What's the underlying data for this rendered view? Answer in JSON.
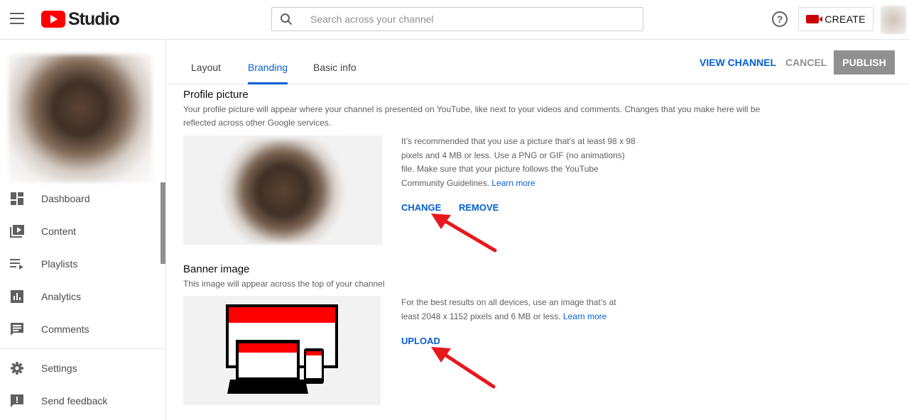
{
  "header": {
    "logo_text": "Studio",
    "search_placeholder": "Search across your channel",
    "create_label": "CREATE"
  },
  "sidebar": {
    "items": [
      {
        "label": "Dashboard",
        "icon": "dashboard-icon"
      },
      {
        "label": "Content",
        "icon": "content-icon"
      },
      {
        "label": "Playlists",
        "icon": "playlists-icon"
      },
      {
        "label": "Analytics",
        "icon": "analytics-icon"
      },
      {
        "label": "Comments",
        "icon": "comments-icon"
      }
    ],
    "bottom_items": [
      {
        "label": "Settings",
        "icon": "gear-icon"
      },
      {
        "label": "Send feedback",
        "icon": "feedback-icon"
      }
    ]
  },
  "tabs": [
    {
      "label": "Layout",
      "active": false
    },
    {
      "label": "Branding",
      "active": true
    },
    {
      "label": "Basic info",
      "active": false
    }
  ],
  "actions": {
    "view_channel": "VIEW CHANNEL",
    "cancel": "CANCEL",
    "publish": "PUBLISH"
  },
  "profile": {
    "title": "Profile picture",
    "description": "Your profile picture will appear where your channel is presented on YouTube, like next to your videos and comments. Changes that you make here will be reflected across other Google services.",
    "hint": "It’s recommended that you use a picture that’s at least 98 x 98 pixels and 4 MB or less. Use a PNG or GIF (no animations) file. Make sure that your picture follows the YouTube Community Guidelines.",
    "learn_more": "Learn more",
    "change_label": "CHANGE",
    "remove_label": "REMOVE"
  },
  "banner": {
    "title": "Banner image",
    "description": "This image will appear across the top of your channel",
    "hint": "For the best results on all devices, use an image that’s at least 2048 x 1152 pixels and 6 MB or less.",
    "learn_more": "Learn more",
    "upload_label": "UPLOAD"
  },
  "colors": {
    "accent": "#065fd4",
    "brand_red": "#ff0000",
    "arrow_red": "#e8171c"
  }
}
